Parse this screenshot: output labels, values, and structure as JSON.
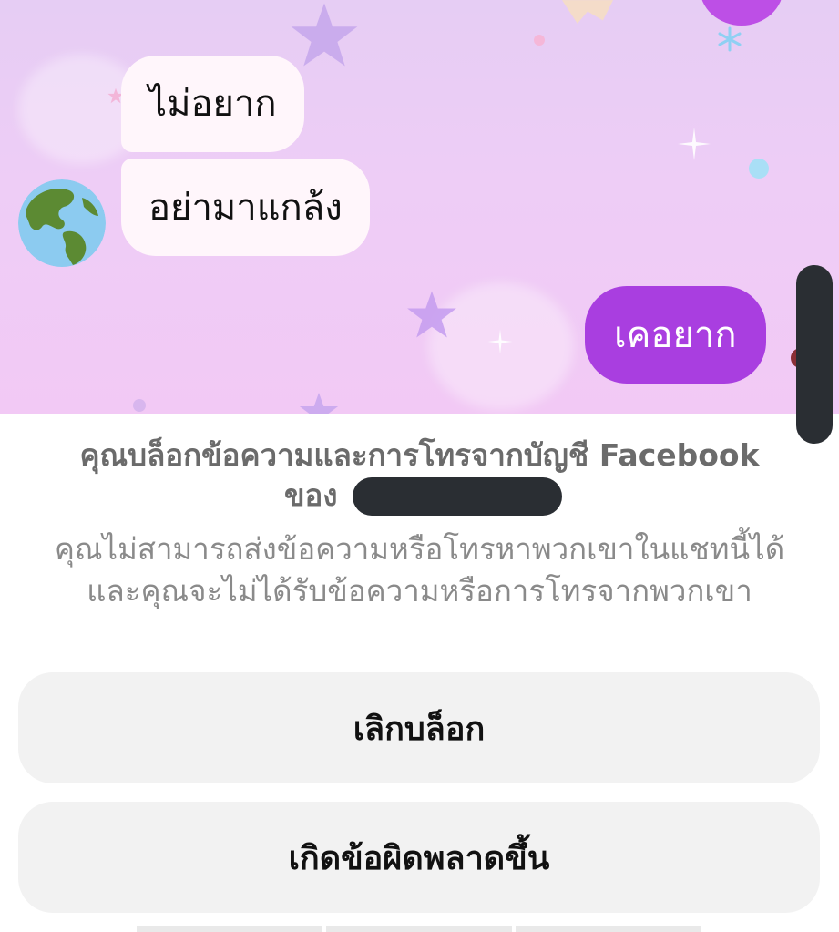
{
  "chat": {
    "messages": [
      {
        "direction": "incoming",
        "text": "ไม่อยาก"
      },
      {
        "direction": "incoming",
        "text": "อย่ามาแกล้ง"
      },
      {
        "direction": "outgoing",
        "text": "เคอยาก"
      }
    ],
    "contact_avatar_icon": "globe-americas-icon",
    "theme_colors": {
      "background": "#eccdf5",
      "outgoing_bubble": "#a93ee0",
      "incoming_bubble": "#fff6fb"
    }
  },
  "block_notice": {
    "title_line1": "คุณบล็อกข้อความและการโทรจากบัญชี Facebook",
    "title_line2_prefix": "ของ",
    "body": "คุณไม่สามารถส่งข้อความหรือโทรหาพวกเขาในแชทนี้ได้ และคุณจะไม่ได้รับข้อความหรือการโทรจากพวกเขา"
  },
  "actions": {
    "unblock_label": "เลิกบล็อก",
    "report_problem_label": "เกิดข้อผิดพลาดขึ้น"
  }
}
